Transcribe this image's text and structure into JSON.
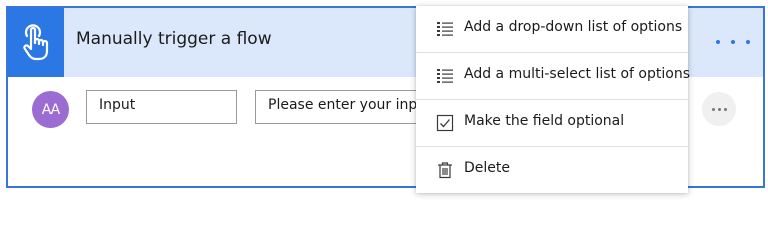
{
  "trigger": {
    "title": "Manually trigger a flow",
    "icon": "touch-hand-icon",
    "accent_color": "#2b78e4",
    "header_bg": "#dbe8fb"
  },
  "input_row": {
    "avatar_text": "AA",
    "avatar_color": "#9b6cd2",
    "name_value": "Input",
    "placeholder_value": "Please enter your input"
  },
  "menu": {
    "items": [
      {
        "label": "Add a drop-down list of options",
        "icon": "list-icon"
      },
      {
        "label": "Add a multi-select list of options",
        "icon": "list-icon"
      },
      {
        "label": "Make the field optional",
        "icon": "checkbox-icon"
      },
      {
        "label": "Delete",
        "icon": "trash-icon"
      }
    ]
  }
}
